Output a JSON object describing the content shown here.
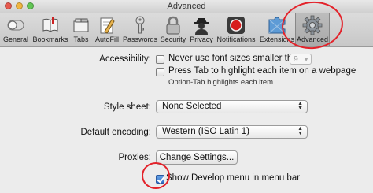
{
  "window": {
    "title": "Advanced"
  },
  "toolbar": {
    "tabs": [
      {
        "label": "General",
        "icon": "switch-icon"
      },
      {
        "label": "Bookmarks",
        "icon": "book-icon"
      },
      {
        "label": "Tabs",
        "icon": "tabs-icon"
      },
      {
        "label": "AutoFill",
        "icon": "pencil-icon"
      },
      {
        "label": "Passwords",
        "icon": "key-icon"
      },
      {
        "label": "Security",
        "icon": "lock-icon"
      },
      {
        "label": "Privacy",
        "icon": "silhouette-icon"
      },
      {
        "label": "Notifications",
        "icon": "notification-icon"
      },
      {
        "label": "Extensions",
        "icon": "puzzle-icon"
      },
      {
        "label": "Advanced",
        "icon": "gear-icon",
        "selected": true
      }
    ]
  },
  "settings": {
    "accessibility": {
      "label": "Accessibility:",
      "min_font_text": "Never use font sizes smaller than",
      "min_font_value": "9",
      "min_font_checked": false,
      "tab_text": "Press Tab to highlight each item on a webpage",
      "tab_checked": false,
      "tab_note": "Option-Tab highlights each item."
    },
    "style_sheet": {
      "label": "Style sheet:",
      "value": "None Selected"
    },
    "encoding": {
      "label": "Default encoding:",
      "value": "Western (ISO Latin 1)"
    },
    "proxies": {
      "label": "Proxies:",
      "button": "Change Settings..."
    },
    "develop_menu": {
      "text": "Show Develop menu in menu bar",
      "checked": true
    }
  },
  "colors": {
    "annotation": "#e3222a",
    "selection_blue": "#2f6fc8"
  }
}
